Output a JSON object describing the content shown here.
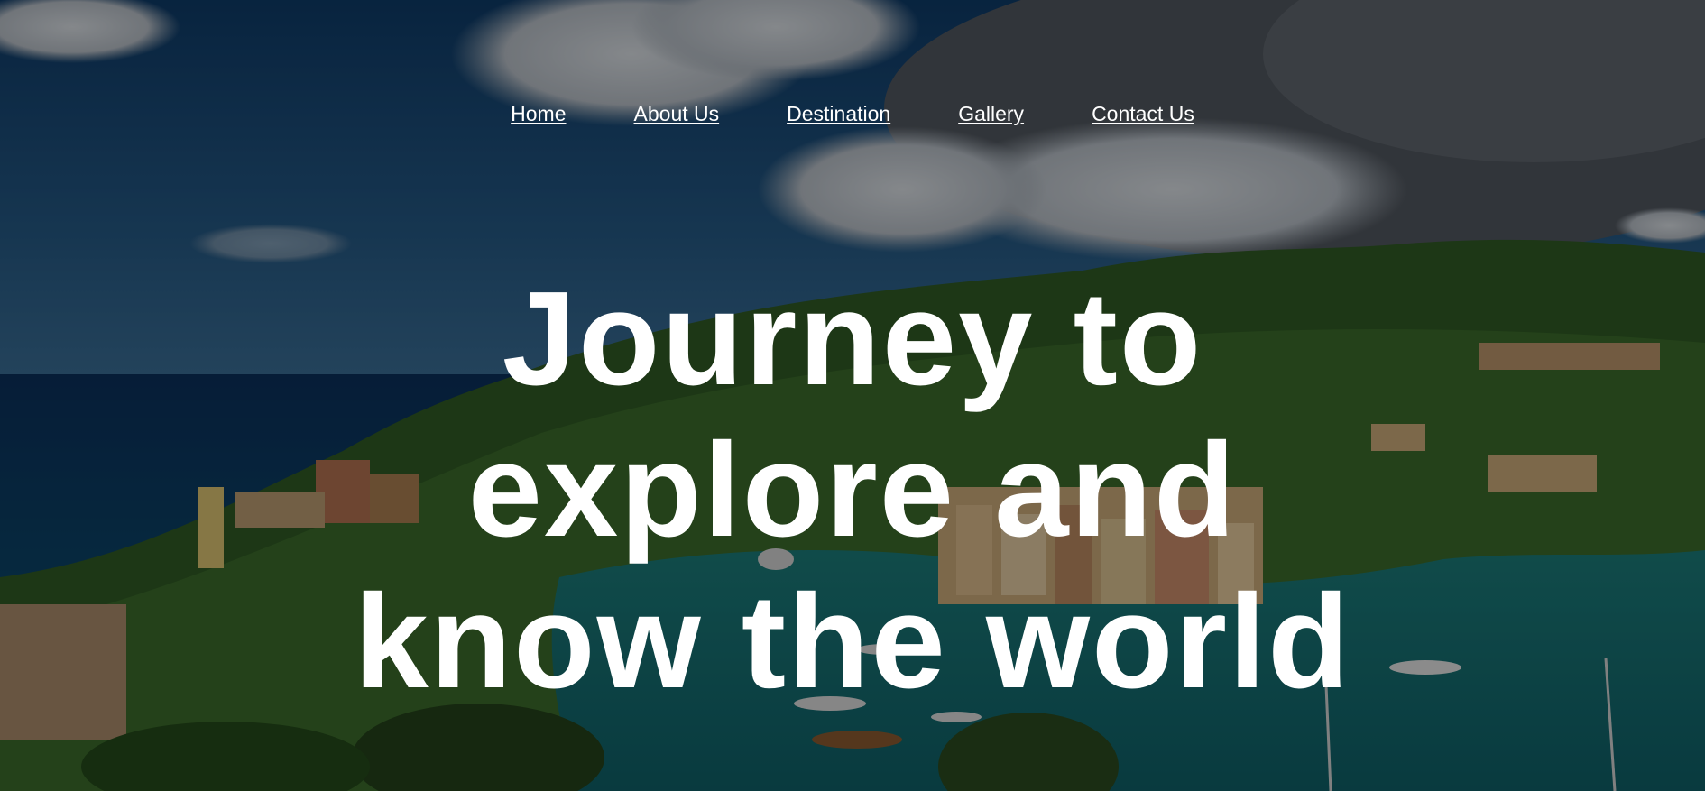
{
  "nav": {
    "items": [
      {
        "label": "Home"
      },
      {
        "label": "About Us"
      },
      {
        "label": "Destination"
      },
      {
        "label": "Gallery"
      },
      {
        "label": "Contact Us"
      }
    ]
  },
  "hero": {
    "headline_lines": [
      "Journey to",
      "explore and",
      "know the world"
    ],
    "background": "coastal harbor village with boats, green hills and cloudy sky"
  },
  "colors": {
    "text": "#ffffff",
    "sky": "#123a5e",
    "sea": "#0c4a5c",
    "hills": "#1f4a1e"
  }
}
